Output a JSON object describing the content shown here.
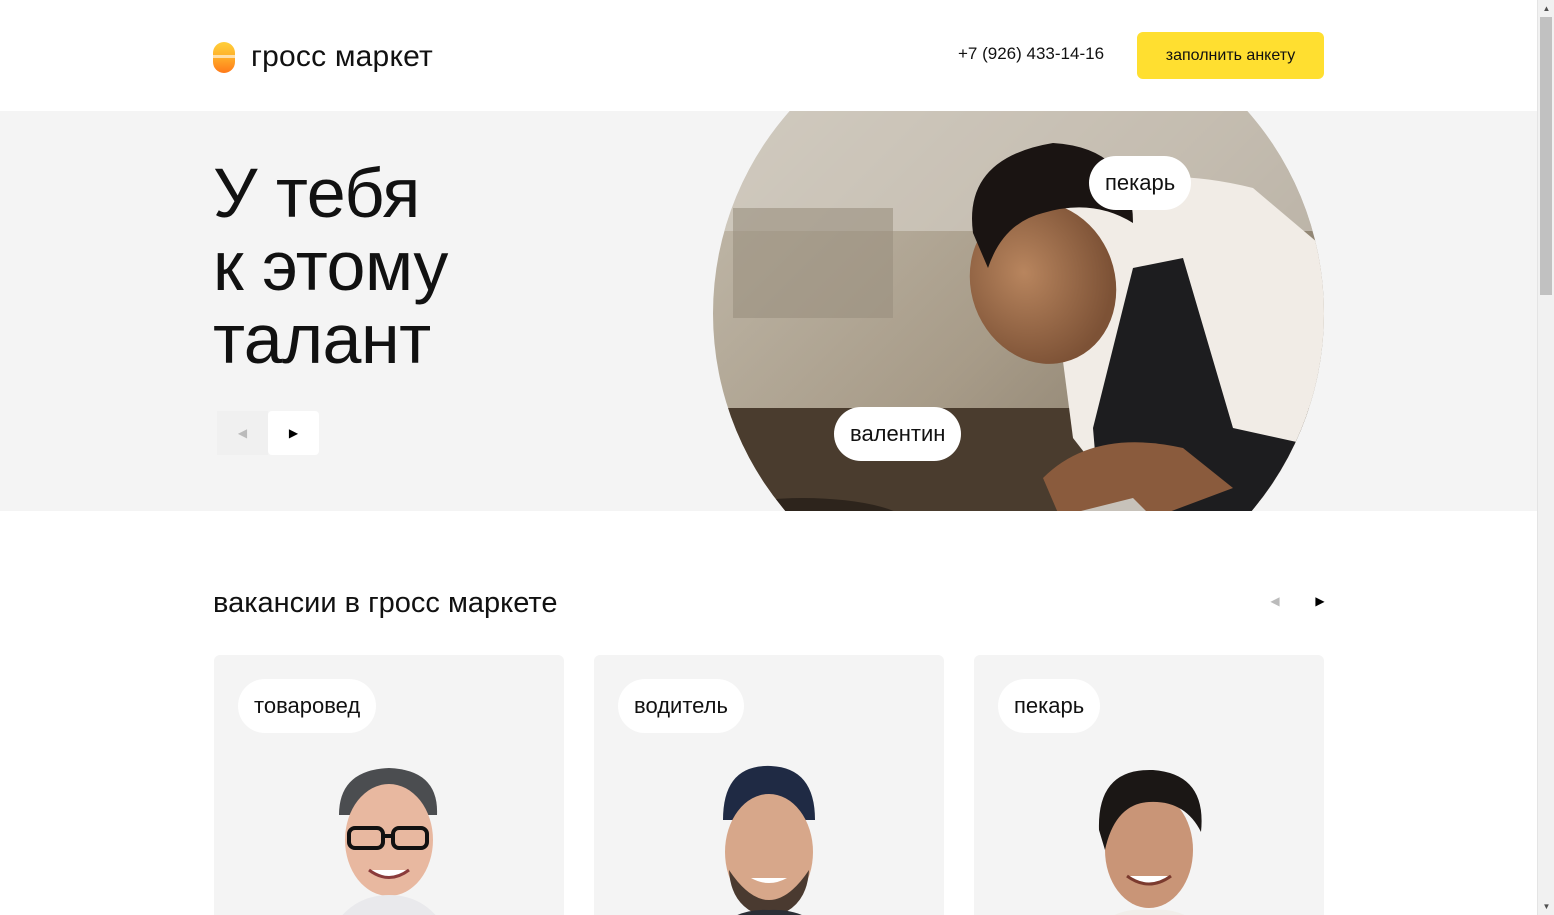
{
  "header": {
    "logo_text": "гросс маркет",
    "phone": "+7 (926) 433-14-16",
    "cta_label": "заполнить анкету"
  },
  "hero": {
    "title_lines": [
      "У тебя",
      "к этому",
      "талант"
    ],
    "role_tag": "пекарь",
    "name_tag": "валентин",
    "prev_icon": "◀",
    "next_icon": "▶"
  },
  "vacancies": {
    "title": "вакансии в гросс маркете",
    "prev_icon": "◀",
    "next_icon": "▶",
    "cards": [
      {
        "role": "товаровед"
      },
      {
        "role": "водитель"
      },
      {
        "role": "пекарь"
      }
    ]
  },
  "colors": {
    "accent": "#ffdf30",
    "hero_bg": "#f4f4f4",
    "card_bg": "#f4f4f4"
  },
  "icons": {
    "logo": "logo-mark-icon",
    "prev": "arrow-left-icon",
    "next": "arrow-right-icon"
  }
}
